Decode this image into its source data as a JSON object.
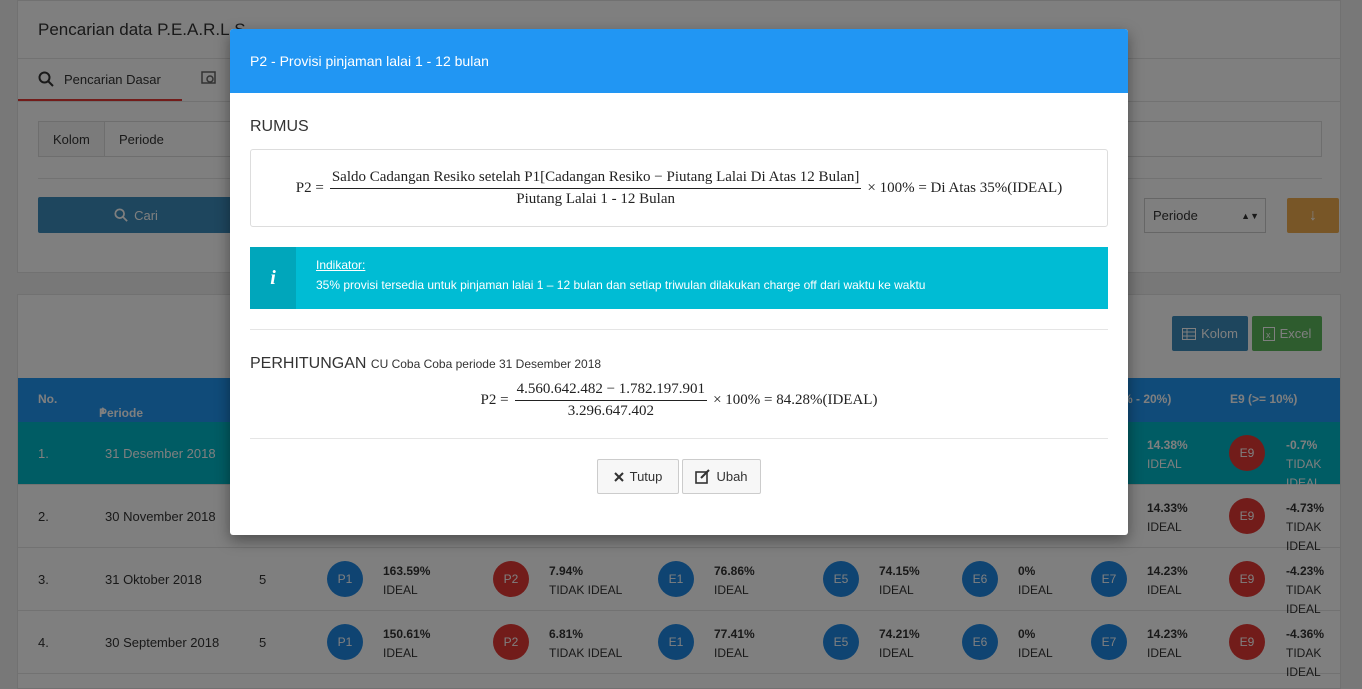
{
  "search": {
    "title": "Pencarian data P.E.A.R.L.S",
    "tab_basic": "Pencarian Dasar",
    "filter_label": "Kolom",
    "filter_value": "Periode",
    "cari_label": "Cari",
    "sort_select": "Periode",
    "download_icon": "↓"
  },
  "table": {
    "kolom_label": "Kolom",
    "excel_label": "Excel",
    "headers": {
      "no": "No.",
      "periode": "Periode",
      "e7": "% - 20%)",
      "e9": "E9 (>= 10%)"
    },
    "rows": [
      {
        "no": "1.",
        "periode": "31 Desember 2018",
        "e7": "14.38%",
        "e7s": "IDEAL",
        "e9": "-0.7%",
        "e9s": "TIDAK IDEAL"
      },
      {
        "no": "2.",
        "periode": "30 November 2018",
        "e7": "14.33%",
        "e7s": "IDEAL",
        "e9": "-4.73%",
        "e9s": "TIDAK IDEAL"
      },
      {
        "no": "3.",
        "periode": "31 Oktober 2018",
        "n": "5",
        "p1": "163.59%",
        "p1s": "IDEAL",
        "p2": "7.94%",
        "p2s": "TIDAK IDEAL",
        "e1": "76.86%",
        "e1s": "IDEAL",
        "e5": "74.15%",
        "e5s": "IDEAL",
        "e6": "0%",
        "e6s": "IDEAL",
        "e7": "14.23%",
        "e7s": "IDEAL",
        "e9": "-4.23%",
        "e9s": "TIDAK IDEAL"
      },
      {
        "no": "4.",
        "periode": "30 September 2018",
        "n": "5",
        "p1": "150.61%",
        "p1s": "IDEAL",
        "p2": "6.81%",
        "p2s": "TIDAK IDEAL",
        "e1": "77.41%",
        "e1s": "IDEAL",
        "e5": "74.21%",
        "e5s": "IDEAL",
        "e6": "0%",
        "e6s": "IDEAL",
        "e7": "14.23%",
        "e7s": "IDEAL",
        "e9": "-4.36%",
        "e9s": "TIDAK IDEAL"
      }
    ],
    "badges": {
      "p1": "P1",
      "p2": "P2",
      "e1": "E1",
      "e5": "E5",
      "e6": "E6",
      "e7": "E7",
      "e9": "E9"
    }
  },
  "modal": {
    "title": "P2 - Provisi pinjaman lalai 1 - 12 bulan",
    "rumus_title": "RUMUS",
    "formula": {
      "lhs": "P2 =",
      "numerator": "Saldo Cadangan Resiko setelah P1[Cadangan Resiko − Piutang Lalai Di Atas 12 Bulan]",
      "denominator": "Piutang Lalai 1 - 12 Bulan",
      "rhs": "× 100% = Di Atas 35%(IDEAL)"
    },
    "info": {
      "icon": "i",
      "heading": "Indikator:",
      "text": "35% provisi tersedia untuk pinjaman lalai 1 – 12 bulan dan setiap triwulan dilakukan charge off dari waktu ke waktu"
    },
    "perhitungan_title": "PERHITUNGAN",
    "perhitungan_sub": "CU Coba Coba periode 31 Desember 2018",
    "calc": {
      "lhs": "P2 =",
      "numerator": "4.560.642.482 − 1.782.197.901",
      "denominator": "3.296.647.402",
      "rhs": "× 100% = 84.28%(IDEAL)"
    },
    "btn_tutup": "Tutup",
    "btn_ubah": "Ubah"
  }
}
